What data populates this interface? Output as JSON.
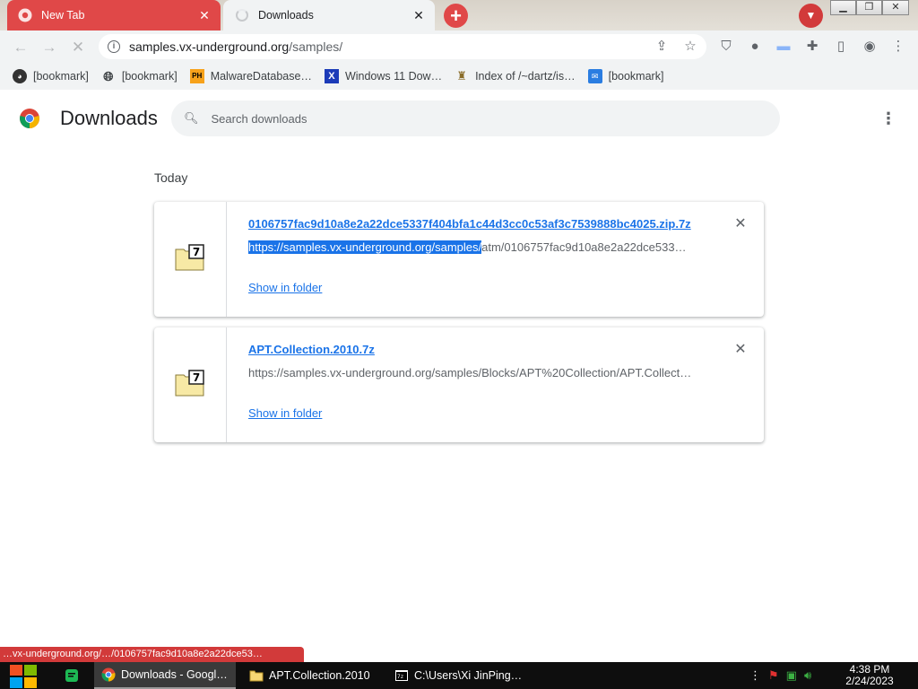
{
  "browser": {
    "tabs": [
      {
        "title": "New Tab",
        "active": false
      },
      {
        "title": "Downloads",
        "active": true
      }
    ],
    "new_tab_symbol": "+",
    "address": {
      "host": "samples.vx-underground.org",
      "path": "/samples/"
    },
    "bookmarks": [
      {
        "label": "[bookmark]",
        "icon": "github-icon"
      },
      {
        "label": "[bookmark]",
        "icon": "globe-icon"
      },
      {
        "label": "MalwareDatabase…",
        "icon": "ph-icon"
      },
      {
        "label": "Windows 11 Dow…",
        "icon": "x-icon"
      },
      {
        "label": "Index of /~dartz/is…",
        "icon": "folder-person-icon"
      },
      {
        "label": "[bookmark]",
        "icon": "blue-badge-icon"
      }
    ],
    "colors": {
      "tab_accent": "#e04848",
      "link": "#1a73e8"
    }
  },
  "downloads_page": {
    "title": "Downloads",
    "search_placeholder": "Search downloads",
    "section_label": "Today",
    "items": [
      {
        "filename": "0106757fac9d10a8e2a22dce5337f404bfa1c44d3cc0c53af3c7539888bc4025.zip.7z",
        "url_selected": "https://samples.vx-underground.org/samples/",
        "url_rest": "atm/0106757fac9d10a8e2a22dce533…",
        "action": "Show in folder"
      },
      {
        "filename": "APT.Collection.2010.7z",
        "url_selected": "",
        "url_rest": "https://samples.vx-underground.org/samples/Blocks/APT%20Collection/APT.Collect…",
        "action": "Show in folder"
      }
    ],
    "status_url": "…vx-underground.org/…/0106757fac9d10a8e2a22dce53…"
  },
  "taskbar": {
    "apps": [
      {
        "label": "Downloads - Googl…",
        "icon": "chrome-icon"
      },
      {
        "label": "APT.Collection.2010",
        "icon": "folder-icon"
      },
      {
        "label": "C:\\Users\\Xi JinPing…",
        "icon": "terminal-icon"
      }
    ],
    "time": "4:38 PM",
    "date": "2/24/2023"
  }
}
